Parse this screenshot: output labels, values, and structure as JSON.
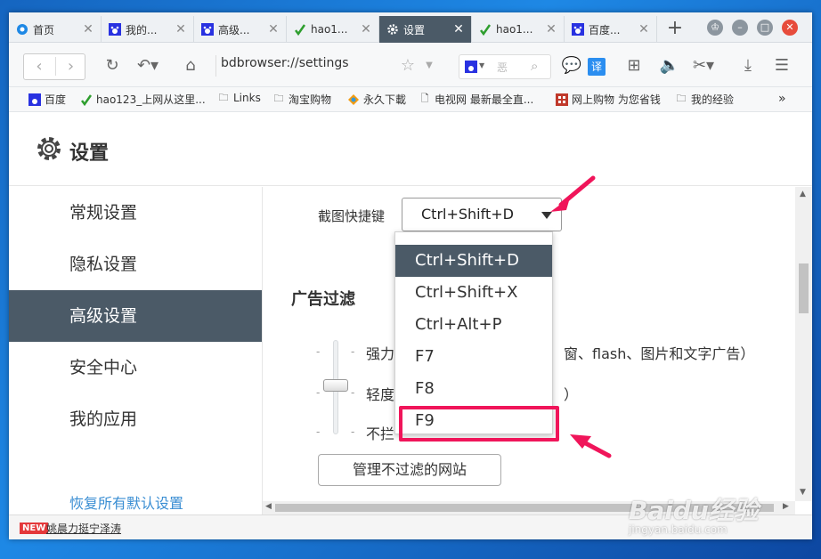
{
  "tabs": [
    {
      "label": "首页",
      "icon": "browser-logo-icon",
      "active": false
    },
    {
      "label": "我的...",
      "icon": "baidu-paw-icon",
      "active": false
    },
    {
      "label": "高级...",
      "icon": "baidu-paw-icon",
      "active": false
    },
    {
      "label": "hao1...",
      "icon": "hao123-icon",
      "active": false
    },
    {
      "label": "设置",
      "icon": "gear-icon",
      "active": true
    },
    {
      "label": "hao1...",
      "icon": "hao123-icon",
      "active": false
    },
    {
      "label": "百度...",
      "icon": "baidu-paw-icon",
      "active": false
    }
  ],
  "address": {
    "url": "bdbrowser://settings",
    "search_placeholder": "恶"
  },
  "bookmarks": [
    {
      "label": "百度",
      "icon": "baidu-paw-icon"
    },
    {
      "label": "hao123_上网从这里...",
      "icon": "hao123-icon"
    },
    {
      "label": "Links",
      "icon": "folder-icon"
    },
    {
      "label": "淘宝购物",
      "icon": "folder-icon"
    },
    {
      "label": "永久下載",
      "icon": "colorful-icon"
    },
    {
      "label": "电视网 最新最全直...",
      "icon": "page-icon"
    },
    {
      "label": "网上购物 为您省钱",
      "icon": "red-grid-icon"
    },
    {
      "label": "我的经验",
      "icon": "folder-icon"
    }
  ],
  "settings": {
    "title": "设置",
    "sidebar": [
      {
        "label": "常规设置",
        "active": false
      },
      {
        "label": "隐私设置",
        "active": false
      },
      {
        "label": "高级设置",
        "active": true
      },
      {
        "label": "安全中心",
        "active": false
      },
      {
        "label": "我的应用",
        "active": false
      }
    ],
    "restore_link": "恢复所有默认设置",
    "screenshot_shortcut_label": "截图快捷键",
    "screenshot_shortcut_value": "Ctrl+Shift+D",
    "shortcut_options": [
      "Ctrl+Shift+D",
      "Ctrl+Shift+X",
      "Ctrl+Alt+P",
      "F7",
      "F8",
      "F9"
    ],
    "ad_filter_title": "广告过滤",
    "ad_filter_options": {
      "strong": "强力拦",
      "strong_tail": "窗、flash、图片和文字广告）",
      "light": "轻度拦",
      "light_tail": "）",
      "none": "不拦"
    },
    "manage_button": "管理不过滤的网站"
  },
  "statusbar": {
    "badge": "NEW",
    "news": "姚晨力挺宁泽涛"
  },
  "watermark": {
    "logo": "Baidu经验",
    "url": "jingyan.baidu.com"
  },
  "colors": {
    "accent_dark": "#4b5a67",
    "highlight": "#f0155a",
    "link": "#3a8ed3"
  }
}
